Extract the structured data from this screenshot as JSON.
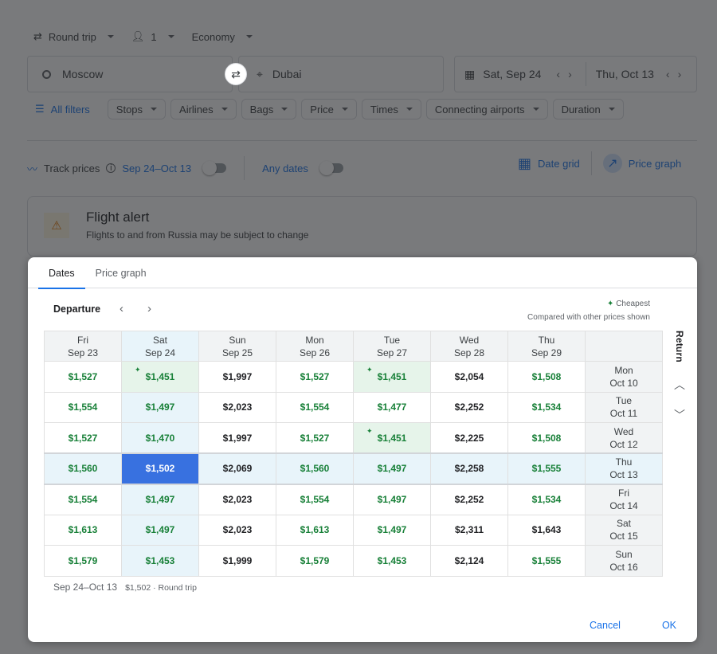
{
  "search": {
    "trip_type": "Round trip",
    "passengers": "1",
    "cabin": "Economy",
    "origin": "Moscow",
    "destination": "Dubai",
    "depart_date": "Sat, Sep 24",
    "return_date": "Thu, Oct 13"
  },
  "filters": {
    "all_filters": "All filters",
    "chips": [
      "Stops",
      "Airlines",
      "Bags",
      "Price",
      "Times",
      "Connecting airports",
      "Duration"
    ]
  },
  "tracking": {
    "label": "Track prices",
    "range": "Sep 24–Oct 13",
    "any_dates": "Any dates"
  },
  "views": {
    "date_grid": "Date grid",
    "price_graph": "Price graph"
  },
  "alert": {
    "title": "Flight alert",
    "message": "Flights to and from Russia may be subject to change"
  },
  "dialog": {
    "tabs": [
      "Dates",
      "Price graph"
    ],
    "active_tab": "Dates",
    "departure_label": "Departure",
    "return_label": "Return",
    "legend_cheapest": "Cheapest",
    "legend_note": "Compared with other prices shown",
    "columns": [
      {
        "day": "Fri",
        "date": "Sep 23"
      },
      {
        "day": "Sat",
        "date": "Sep 24"
      },
      {
        "day": "Sun",
        "date": "Sep 25"
      },
      {
        "day": "Mon",
        "date": "Sep 26"
      },
      {
        "day": "Tue",
        "date": "Sep 27"
      },
      {
        "day": "Wed",
        "date": "Sep 28"
      },
      {
        "day": "Thu",
        "date": "Sep 29"
      }
    ],
    "rows": [
      {
        "day": "Mon",
        "date": "Oct 10",
        "prices": [
          "$1,527",
          "$1,451",
          "$1,997",
          "$1,527",
          "$1,451",
          "$2,054",
          "$1,508"
        ],
        "cheap": [
          1,
          1,
          0,
          1,
          1,
          0,
          1
        ],
        "best": [
          0,
          1,
          0,
          0,
          1,
          0,
          0
        ]
      },
      {
        "day": "Tue",
        "date": "Oct 11",
        "prices": [
          "$1,554",
          "$1,497",
          "$2,023",
          "$1,554",
          "$1,477",
          "$2,252",
          "$1,534"
        ],
        "cheap": [
          1,
          1,
          0,
          1,
          1,
          0,
          1
        ],
        "best": [
          0,
          0,
          0,
          0,
          0,
          0,
          0
        ]
      },
      {
        "day": "Wed",
        "date": "Oct 12",
        "prices": [
          "$1,527",
          "$1,470",
          "$1,997",
          "$1,527",
          "$1,451",
          "$2,225",
          "$1,508"
        ],
        "cheap": [
          1,
          1,
          0,
          1,
          1,
          0,
          1
        ],
        "best": [
          0,
          0,
          0,
          0,
          1,
          0,
          0
        ]
      },
      {
        "day": "Thu",
        "date": "Oct 13",
        "prices": [
          "$1,560",
          "$1,502",
          "$2,069",
          "$1,560",
          "$1,497",
          "$2,258",
          "$1,555"
        ],
        "cheap": [
          1,
          1,
          0,
          1,
          1,
          0,
          1
        ],
        "best": [
          0,
          0,
          0,
          0,
          0,
          0,
          0
        ]
      },
      {
        "day": "Fri",
        "date": "Oct 14",
        "prices": [
          "$1,554",
          "$1,497",
          "$2,023",
          "$1,554",
          "$1,497",
          "$2,252",
          "$1,534"
        ],
        "cheap": [
          1,
          1,
          0,
          1,
          1,
          0,
          1
        ],
        "best": [
          0,
          0,
          0,
          0,
          0,
          0,
          0
        ]
      },
      {
        "day": "Sat",
        "date": "Oct 15",
        "prices": [
          "$1,613",
          "$1,497",
          "$2,023",
          "$1,613",
          "$1,497",
          "$2,311",
          "$1,643"
        ],
        "cheap": [
          1,
          1,
          0,
          1,
          1,
          0,
          0
        ],
        "best": [
          0,
          0,
          0,
          0,
          0,
          0,
          0
        ]
      },
      {
        "day": "Sun",
        "date": "Oct 16",
        "prices": [
          "$1,579",
          "$1,453",
          "$1,999",
          "$1,579",
          "$1,453",
          "$2,124",
          "$1,555"
        ],
        "cheap": [
          1,
          1,
          0,
          1,
          1,
          0,
          1
        ],
        "best": [
          0,
          0,
          0,
          0,
          0,
          0,
          0
        ]
      }
    ],
    "selected": {
      "column": 1,
      "row": 3
    },
    "summary_dates": "Sep 24–Oct 13",
    "summary_info": "$1,502 · Round trip",
    "cancel": "Cancel",
    "ok": "OK"
  },
  "colors": {
    "accent": "#1a73e8",
    "cheap_text": "#188038",
    "selected_cell": "#3871e0",
    "selected_band": "#e8f4fa",
    "cheapest_fill": "#e6f4ea"
  }
}
